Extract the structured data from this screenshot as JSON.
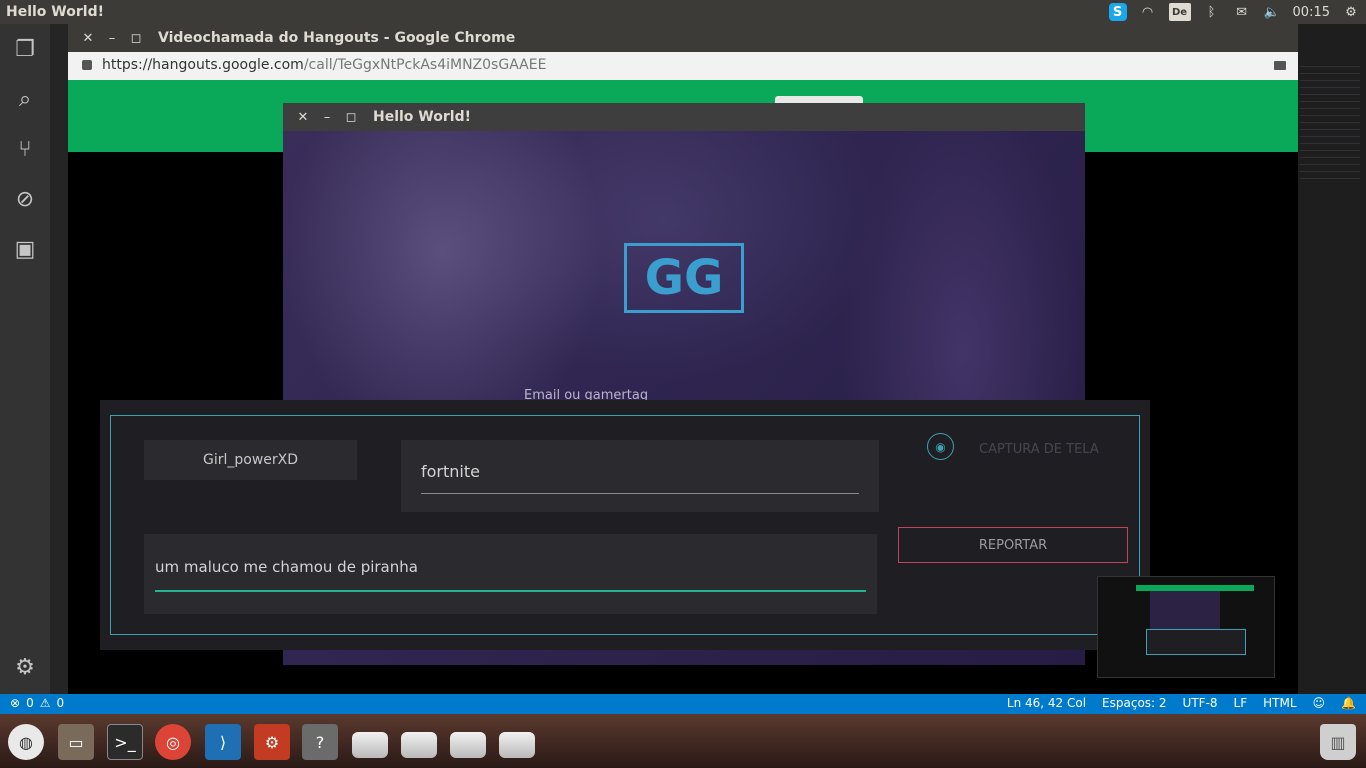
{
  "topbar": {
    "app_title": "Hello World!",
    "keyboard_layout": "De",
    "clock": "00:15"
  },
  "statusbar": {
    "errors": "0",
    "warnings": "0",
    "position": "Ln 46, 42 Col",
    "spaces": "Espaços: 2",
    "encoding": "UTF-8",
    "eol": "LF",
    "language": "HTML"
  },
  "chrome": {
    "title": "Videochamada do Hangouts - Google Chrome",
    "url_host": "https://hangouts.google.com",
    "url_path": "/call/TeGgxNtPckAs4iMNZ0sGAAEE"
  },
  "hello_window": {
    "title": "Hello World!",
    "logo_text": "GG",
    "email_placeholder": "Email ou gamertag"
  },
  "report_panel": {
    "username": "Girl_powerXD",
    "game": "fortnite",
    "message": "um maluco me chamou de piranha",
    "capture_label": "CAPTURA DE TELA",
    "report_button": "REPORTAR"
  },
  "icons": {
    "activity": [
      "files-icon",
      "search-icon",
      "source-control-icon",
      "debug-icon",
      "extensions-icon",
      "settings-gear-icon"
    ],
    "dock": [
      "ubuntu-logo-icon",
      "files-app-icon",
      "terminal-icon",
      "chrome-icon",
      "vscode-icon",
      "system-settings-icon",
      "help-icon",
      "disk-icon",
      "trash-icon"
    ]
  },
  "colors": {
    "hangouts_green": "#0aa859",
    "vscode_blue": "#007acc",
    "gg_blue": "#3a9fcf",
    "panel_accent": "#3ba1b3",
    "message_underline": "#1fb592",
    "report_border": "#c0445a"
  }
}
